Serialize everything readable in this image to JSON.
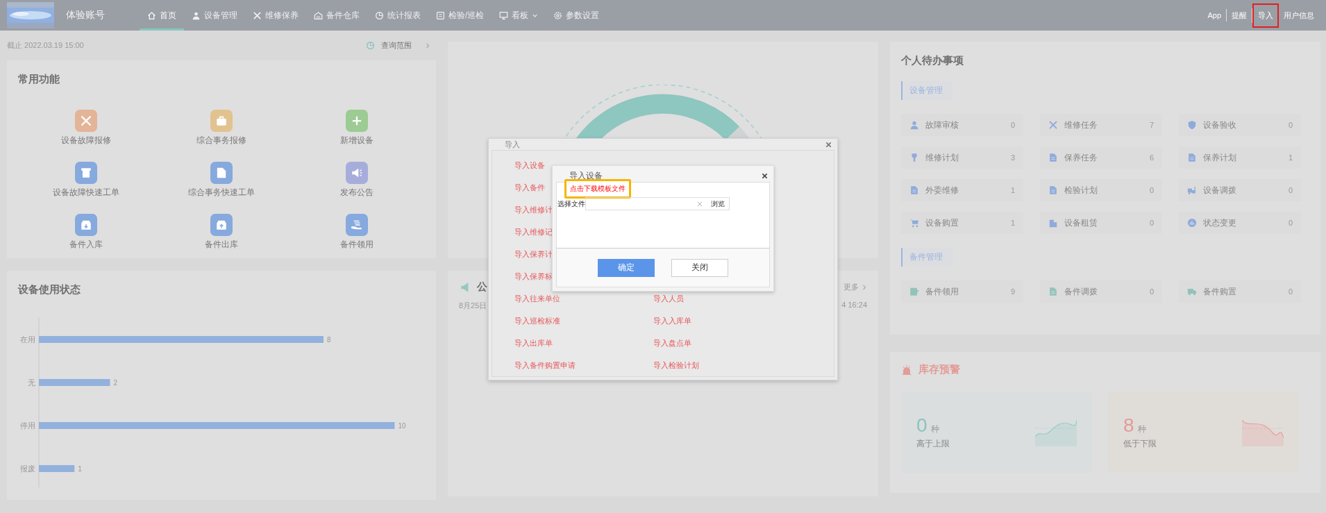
{
  "top_bar": {
    "account": "体验账号",
    "nav": [
      {
        "label": "首页",
        "selected": true,
        "dropdown": false
      },
      {
        "label": "设备管理",
        "selected": false,
        "dropdown": false
      },
      {
        "label": "维修保养",
        "selected": false,
        "dropdown": false
      },
      {
        "label": "备件仓库",
        "selected": false,
        "dropdown": false
      },
      {
        "label": "统计报表",
        "selected": false,
        "dropdown": false
      },
      {
        "label": "检验/巡检",
        "selected": false,
        "dropdown": false
      },
      {
        "label": "看板",
        "selected": false,
        "dropdown": true
      },
      {
        "label": "参数设置",
        "selected": false,
        "dropdown": false
      }
    ],
    "links": [
      {
        "label": "App",
        "highlighted": false
      },
      {
        "label": "提醒",
        "highlighted": false
      },
      {
        "label": "导入",
        "highlighted": true
      },
      {
        "label": "用户信息",
        "highlighted": false
      }
    ]
  },
  "date_line": "截止 2022.03.19 15:00",
  "range_button": "查询范围",
  "quick_functions": {
    "title": "常用功能",
    "items": [
      {
        "label": "设备故障报修",
        "color": "#e3b497"
      },
      {
        "label": "综合事务报修",
        "color": "#e2c38f"
      },
      {
        "label": "新增设备",
        "color": "#9ccb93"
      },
      {
        "label": "设备故障快速工单",
        "color": "#86a9de"
      },
      {
        "label": "综合事务快速工单",
        "color": "#86a9de"
      },
      {
        "label": "发布公告",
        "color": "#a7addb"
      },
      {
        "label": "备件入库",
        "color": "#86a9de"
      },
      {
        "label": "备件出库",
        "color": "#86a9de"
      },
      {
        "label": "备件领用",
        "color": "#86a9de"
      }
    ]
  },
  "usage_status": {
    "title": "设备使用状态",
    "chart_data": {
      "type": "bar",
      "orientation": "horizontal",
      "categories": [
        "在用",
        "无",
        "停用",
        "报废"
      ],
      "values": [
        8,
        2,
        10,
        1
      ],
      "data_labels": true
    }
  },
  "announcement": {
    "title": "公",
    "date": "8月25日",
    "more": "更多",
    "time": "4 16:24"
  },
  "todo": {
    "title": "个人待办事项",
    "sections": [
      {
        "title": "设备管理",
        "items": [
          {
            "label": "故障审核",
            "count": "0"
          },
          {
            "label": "维修任务",
            "count": "7"
          },
          {
            "label": "设备验收",
            "count": "0"
          },
          {
            "label": "维修计划",
            "count": "3"
          },
          {
            "label": "保养任务",
            "count": "6"
          },
          {
            "label": "保养计划",
            "count": "1"
          },
          {
            "label": "外委维修",
            "count": "1"
          },
          {
            "label": "检验计划",
            "count": "0"
          },
          {
            "label": "设备调拨",
            "count": "0"
          },
          {
            "label": "设备购置",
            "count": "1"
          },
          {
            "label": "设备租赁",
            "count": "0"
          },
          {
            "label": "状态变更",
            "count": "0"
          }
        ]
      },
      {
        "title": "备件管理",
        "items": [
          {
            "label": "备件领用",
            "count": "9"
          },
          {
            "label": "备件调拨",
            "count": "0"
          },
          {
            "label": "备件购置",
            "count": "0"
          }
        ]
      }
    ]
  },
  "stock_alert": {
    "title": "库存预警",
    "cards": [
      {
        "kind": "above",
        "value": "0",
        "unit": "种",
        "label": "高于上限"
      },
      {
        "kind": "below",
        "value": "8",
        "unit": "种",
        "label": "低于下限"
      }
    ]
  },
  "import_dialog": {
    "title": "导入",
    "left_column": [
      "导入设备",
      "导入备件",
      "导入维修计",
      "导入维修记",
      "导入保养计",
      "导入保养标",
      "导入往来单位",
      "导入巡检标准",
      "导入出库单",
      "导入备件购置申请"
    ],
    "right_column": [
      "导入人员",
      "导入入库单",
      "导入盘点单",
      "导入检验计划"
    ]
  },
  "import_device_dialog": {
    "title": "导入设备",
    "template_link": "点击下载模板文件",
    "file_label": "选择文件",
    "browse": "浏览",
    "buttons": [
      {
        "label": "确定",
        "kind": "primary"
      },
      {
        "label": "关闭",
        "kind": "default"
      }
    ]
  }
}
